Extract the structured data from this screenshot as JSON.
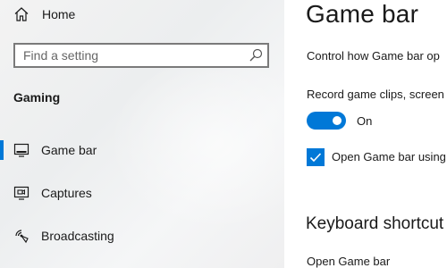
{
  "sidebar": {
    "home_label": "Home",
    "search_placeholder": "Find a setting",
    "section_title": "Gaming",
    "items": [
      {
        "label": "Game bar",
        "icon": "game-bar-icon",
        "selected": true
      },
      {
        "label": "Captures",
        "icon": "captures-icon",
        "selected": false
      },
      {
        "label": "Broadcasting",
        "icon": "broadcasting-icon",
        "selected": false
      }
    ]
  },
  "main": {
    "title": "Game bar",
    "description": "Control how Game bar op",
    "record_label": "Record game clips, screen",
    "record_toggle": {
      "state": "On",
      "on": true
    },
    "open_checkbox": {
      "label": "Open Game bar using",
      "checked": true
    },
    "keyboard_heading": "Keyboard shortcut",
    "open_shortcut_label": "Open Game bar"
  },
  "colors": {
    "accent": "#0078d7",
    "sidebar_bg": "#f0f1f2",
    "text": "#1a1a1a"
  }
}
